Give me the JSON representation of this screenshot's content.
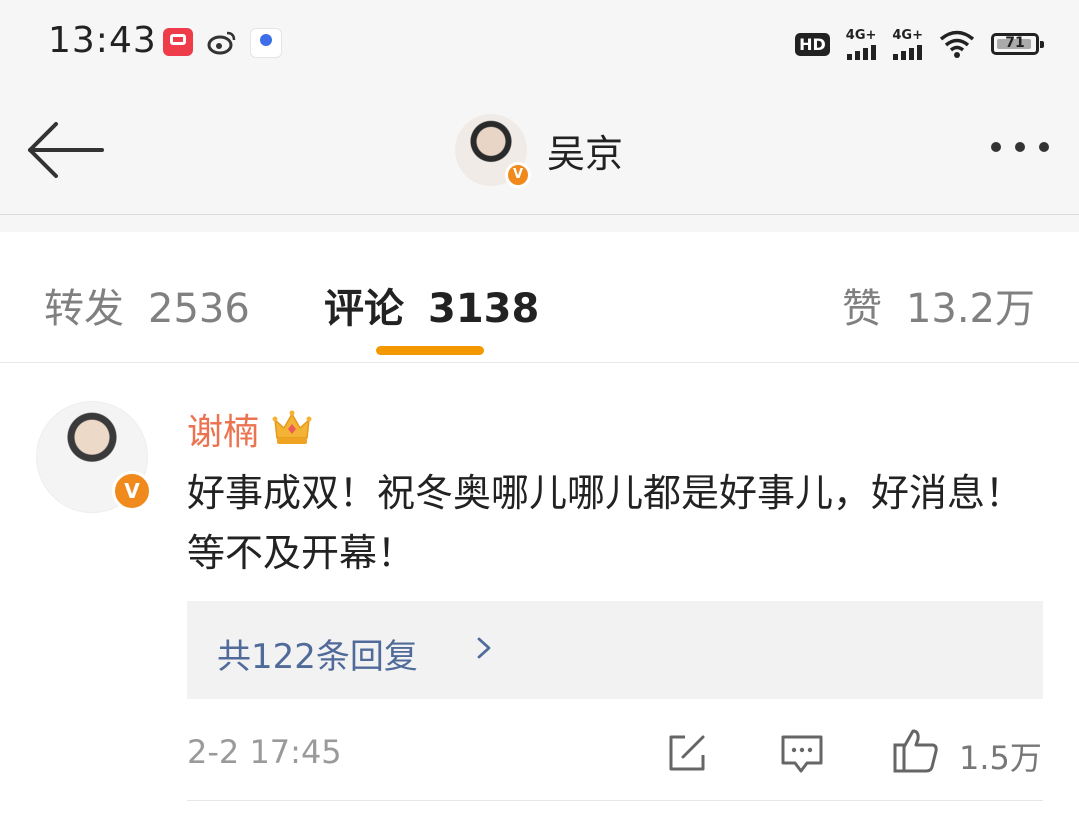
{
  "status_bar": {
    "time": "13:43",
    "apps": [
      "kuaishou-icon",
      "weibo-icon",
      "baidu-icon"
    ],
    "hd_label": "HD",
    "sim1_network": "4G+",
    "sim2_network": "4G+",
    "battery_level": "71"
  },
  "header": {
    "title": "吴京",
    "verified_mark": "V"
  },
  "tabs": {
    "repost": {
      "label": "转发",
      "count": "2536"
    },
    "comments": {
      "label": "评论",
      "count": "3138"
    },
    "likes": {
      "label": "赞",
      "count": "13.2万"
    },
    "active": "comments",
    "accent_color": "#f39800"
  },
  "comment": {
    "author": "谢楠",
    "verified_mark": "V",
    "text": "好事成双！祝冬奥哪儿哪儿都是好事儿，好消息！等不及开幕！",
    "replies_label": "共122条回复",
    "timestamp": "2-2  17:45",
    "like_count": "1.5万",
    "author_color": "#eb7350",
    "link_color": "#506b9a"
  }
}
